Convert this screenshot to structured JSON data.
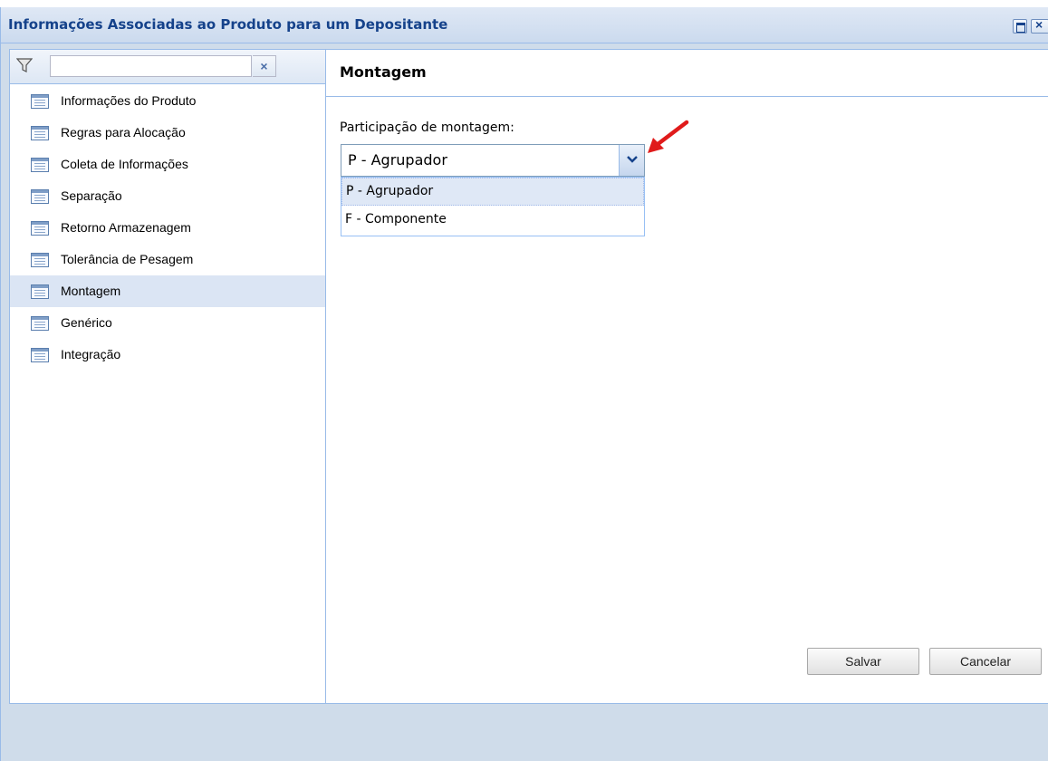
{
  "window": {
    "title": "Informações Associadas ao Produto para um Depositante"
  },
  "filter": {
    "value": "",
    "clear_label": "×"
  },
  "sidebar": {
    "items": [
      {
        "label": "Informações do Produto",
        "selected": false
      },
      {
        "label": "Regras para Alocação",
        "selected": false
      },
      {
        "label": "Coleta de Informações",
        "selected": false
      },
      {
        "label": "Separação",
        "selected": false
      },
      {
        "label": "Retorno Armazenagem",
        "selected": false
      },
      {
        "label": "Tolerância de Pesagem",
        "selected": false
      },
      {
        "label": "Montagem",
        "selected": true
      },
      {
        "label": "Genérico",
        "selected": false
      },
      {
        "label": "Integração",
        "selected": false
      }
    ]
  },
  "main": {
    "section_title": "Montagem",
    "field_label": "Participação de montagem:",
    "field_value": "P - Agrupador",
    "options": [
      "P - Agrupador",
      "F - Componente"
    ]
  },
  "footer": {
    "save_label": "Salvar",
    "cancel_label": "Cancelar"
  },
  "colors": {
    "title_text": "#15428b",
    "selected_row": "#dbe5f4",
    "annotation_arrow": "#e01b1b"
  }
}
